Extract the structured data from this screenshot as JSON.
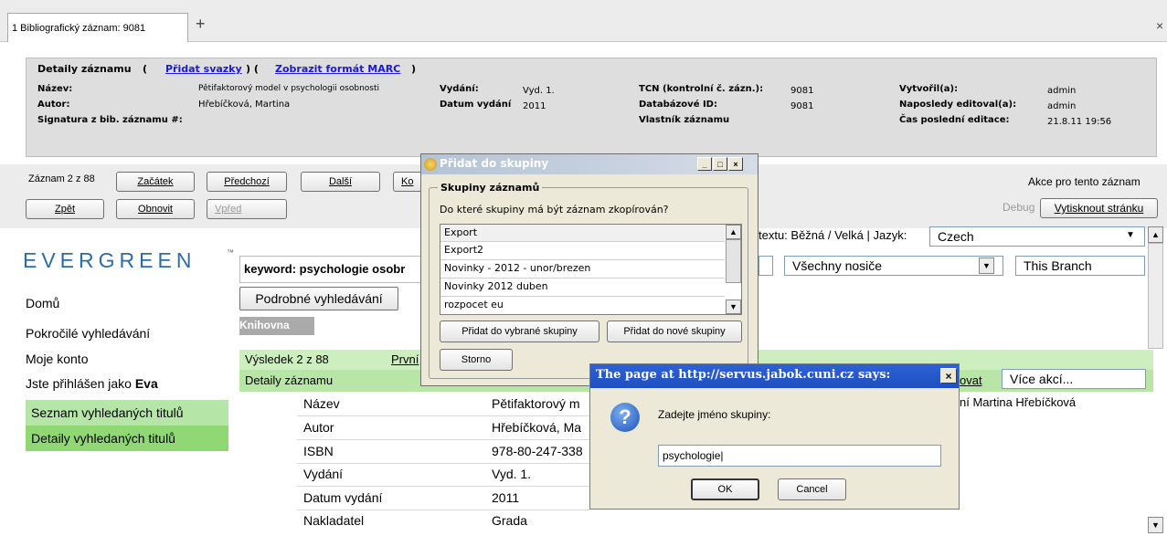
{
  "tabs": {
    "tab1_label": "1 Bibliografický záznam: 9081",
    "plus": "+",
    "close": "×"
  },
  "header": {
    "title_label": "Detaily záznamu",
    "open_paren": "(",
    "add_volumes": "Přidat svazky",
    "sep": ") (",
    "show_marc": "Zobrazit formát MARC",
    "close_paren": ")",
    "nazev_label": "Název:",
    "nazev_value": "Pětifaktorový model v psychologii osobnosti",
    "autor_label": "Autor:",
    "autor_value": "Hřebíčková, Martina",
    "signatura_label": "Signatura z bib. záznamu #:",
    "vydani_label": "Vydání:",
    "vydani_value": "Vyd. 1.",
    "datum_label": "Datum vydání",
    "datum_value": "2011",
    "tcn_label": "TCN (kontrolní č. zázn.):",
    "tcn_value": "9081",
    "dbid_label": "Databázové ID:",
    "dbid_value": "9081",
    "owner_label": "Vlastník záznamu",
    "created_label": "Vytvořil(a):",
    "created_value": "admin",
    "edited_label": "Naposledy editoval(a):",
    "edited_value": "admin",
    "edittime_label": "Čas poslední editace:",
    "edittime_value": "21.8.11 19:56"
  },
  "nav": {
    "record_count": "Záznam 2 z 88",
    "start": "Začátek",
    "prev": "Předchozí",
    "next": "Další",
    "last": "Ko",
    "back": "Zpět",
    "refresh": "Obnovit",
    "forward": "Vpřed",
    "actions": "Akce pro tento záznam",
    "debug": "Debug",
    "print": "Vytisknout stránku"
  },
  "opac": {
    "logo": "EVERGREEN",
    "tm": "™",
    "search_value": "keyword: psychologie osobr",
    "advanced_btn": "Podrobné vyhledávání",
    "library_label": "Knihovna",
    "text_size": "textu: Běžná / Velká | Jazyk:",
    "lang": "Czech",
    "formats": "Všechny nosiče",
    "branch": "This Branch",
    "result": "Výsledek 2 z 88",
    "first": "První",
    "details_hdr": "Detaily záznamu",
    "more_actions": "Více akcí...",
    "ovat": "ovat",
    "author_tail": "ní Martina Hřebíčková",
    "rows": [
      {
        "label": "Název",
        "value": "Pětifaktorový m"
      },
      {
        "label": "Autor",
        "value": "Hřebíčková, Ma"
      },
      {
        "label": "ISBN",
        "value": "978-80-247-338"
      },
      {
        "label": "Vydání",
        "value": "Vyd. 1."
      },
      {
        "label": "Datum vydání",
        "value": "2011"
      },
      {
        "label": "Nakladatel",
        "value": "Grada"
      }
    ]
  },
  "sidebar": {
    "items": [
      "Domů",
      "Pokročilé vyhledávání",
      "Moje konto",
      "Jste přihlášen jako ",
      "Seznam vyhledaných titulů",
      "Detaily vyhledaných titulů"
    ],
    "user": "Eva"
  },
  "dialog1": {
    "title": "Přidat do skupiny",
    "group_label": "Skupiny záznamů",
    "question": "Do které skupiny má být záznam zkopírován?",
    "items": [
      "Export",
      "Export2",
      "Novinky - 2012 - unor/brezen",
      "Novinky 2012 duben",
      "rozpocet eu"
    ],
    "add_selected": "Přidat do vybrané skupiny",
    "add_new": "Přidat do nové skupiny",
    "cancel": "Storno",
    "min": "_",
    "max": "□",
    "close": "×"
  },
  "dialog2": {
    "title": "The page at http://servus.jabok.cuni.cz says:",
    "message": "Zadejte jméno skupiny:",
    "input_value": "psychologie",
    "ok": "OK",
    "cancel": "Cancel",
    "close": "×",
    "icon_glyph": "?"
  }
}
